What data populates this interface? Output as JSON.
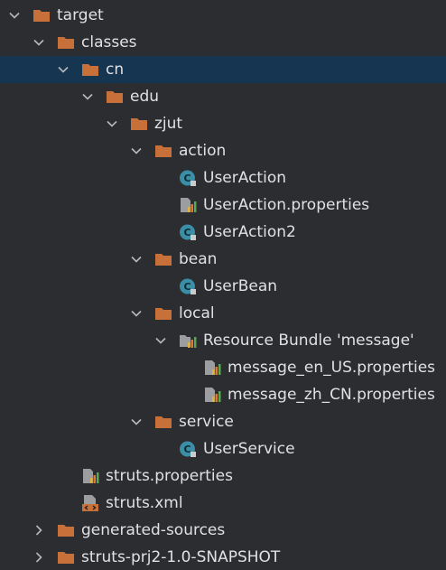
{
  "colors": {
    "background": "#2b2d30",
    "selected_row": "#163550",
    "folder": "#c7703a",
    "text": "#dfe1e5",
    "arrow": "#b7b9bd",
    "class_icon": "#3a8ea6"
  },
  "tree": [
    {
      "label": "target",
      "expanded": true,
      "icon": "folder-icon"
    },
    {
      "label": "classes",
      "expanded": true,
      "icon": "folder-icon"
    },
    {
      "label": "cn",
      "expanded": true,
      "icon": "folder-icon",
      "selected": true
    },
    {
      "label": "edu",
      "expanded": true,
      "icon": "folder-icon"
    },
    {
      "label": "zjut",
      "expanded": true,
      "icon": "folder-icon"
    },
    {
      "label": "action",
      "expanded": true,
      "icon": "folder-icon"
    },
    {
      "label": "UserAction",
      "icon": "java-class-icon"
    },
    {
      "label": "UserAction.properties",
      "icon": "properties-file-icon"
    },
    {
      "label": "UserAction2",
      "icon": "java-class-icon"
    },
    {
      "label": "bean",
      "expanded": true,
      "icon": "folder-icon"
    },
    {
      "label": "UserBean",
      "icon": "java-class-icon"
    },
    {
      "label": "local",
      "expanded": true,
      "icon": "folder-icon"
    },
    {
      "label": "Resource Bundle 'message'",
      "expanded": true,
      "icon": "resource-bundle-icon"
    },
    {
      "label": "message_en_US.properties",
      "icon": "properties-file-icon"
    },
    {
      "label": "message_zh_CN.properties",
      "icon": "properties-file-icon"
    },
    {
      "label": "service",
      "expanded": true,
      "icon": "folder-icon"
    },
    {
      "label": "UserService",
      "icon": "java-class-icon"
    },
    {
      "label": "struts.properties",
      "icon": "properties-file-icon"
    },
    {
      "label": "struts.xml",
      "icon": "xml-file-icon"
    },
    {
      "label": "generated-sources",
      "expanded": false,
      "icon": "folder-icon"
    },
    {
      "label": "struts-prj2-1.0-SNAPSHOT",
      "expanded": false,
      "icon": "folder-icon"
    }
  ]
}
